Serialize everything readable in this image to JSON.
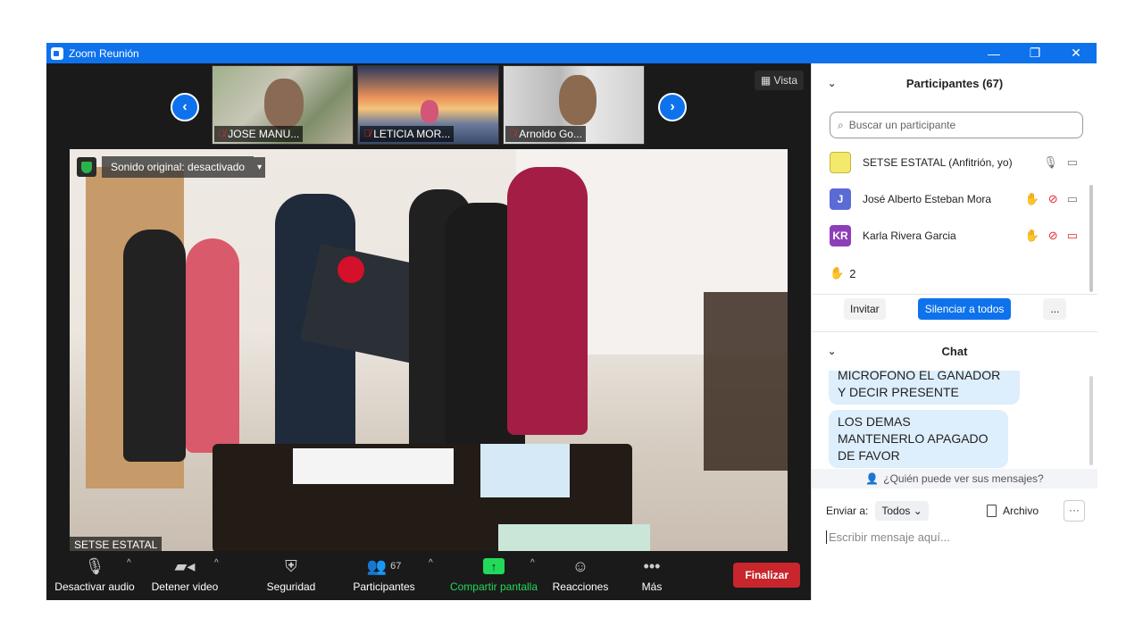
{
  "window": {
    "title": "Zoom Reunión",
    "min": "—",
    "restore": "❐",
    "close": "✕"
  },
  "gallery": {
    "thumbnails": [
      {
        "name": "JOSE MANU..."
      },
      {
        "name": "LETICIA MOR..."
      },
      {
        "name": "Arnoldo Go..."
      }
    ],
    "prev": "‹",
    "next": "›",
    "view_label": "Vista"
  },
  "main_video": {
    "sound_banner": "Sonido original: desactivado",
    "speaker_name": "SETSE ESTATAL"
  },
  "toolbar": {
    "audio": "Desactivar audio",
    "video": "Detener video",
    "security": "Seguridad",
    "participants": "Participantes",
    "participants_count": "67",
    "share": "Compartir pantalla",
    "reactions": "Reacciones",
    "more": "Más",
    "end": "Finalizar"
  },
  "participants_panel": {
    "title": "Participantes (67)",
    "search_placeholder": "Buscar un participante",
    "participants": [
      {
        "name": "SETSE ESTATAL (Anfitrión, yo)",
        "initials": ""
      },
      {
        "name": "José Alberto Esteban Mora",
        "initials": "J",
        "avatar_color": "#5b6bd6"
      },
      {
        "name": "Karla Rivera Garcia",
        "initials": "KR",
        "avatar_color": "#8e3fb8"
      }
    ],
    "raised_hands": "2",
    "invite": "Invitar",
    "mute_all": "Silenciar a todos",
    "more": "..."
  },
  "chat": {
    "title": "Chat",
    "messages": [
      {
        "text": "MICROFONO EL GANADOR Y DECIR PRESENTE"
      },
      {
        "text": "LOS DEMAS MANTENERLO APAGADO DE FAVOR"
      }
    ],
    "who_can_see": "¿Quién puede ver sus mensajes?",
    "send_to_label": "Enviar a:",
    "send_to_value": "Todos",
    "file_label": "Archivo",
    "more": "···",
    "input_placeholder": "Escribir mensaje aquí..."
  },
  "colors": {
    "accent": "#0e72ed",
    "end_button": "#c9252c",
    "share_green": "#23d959"
  }
}
